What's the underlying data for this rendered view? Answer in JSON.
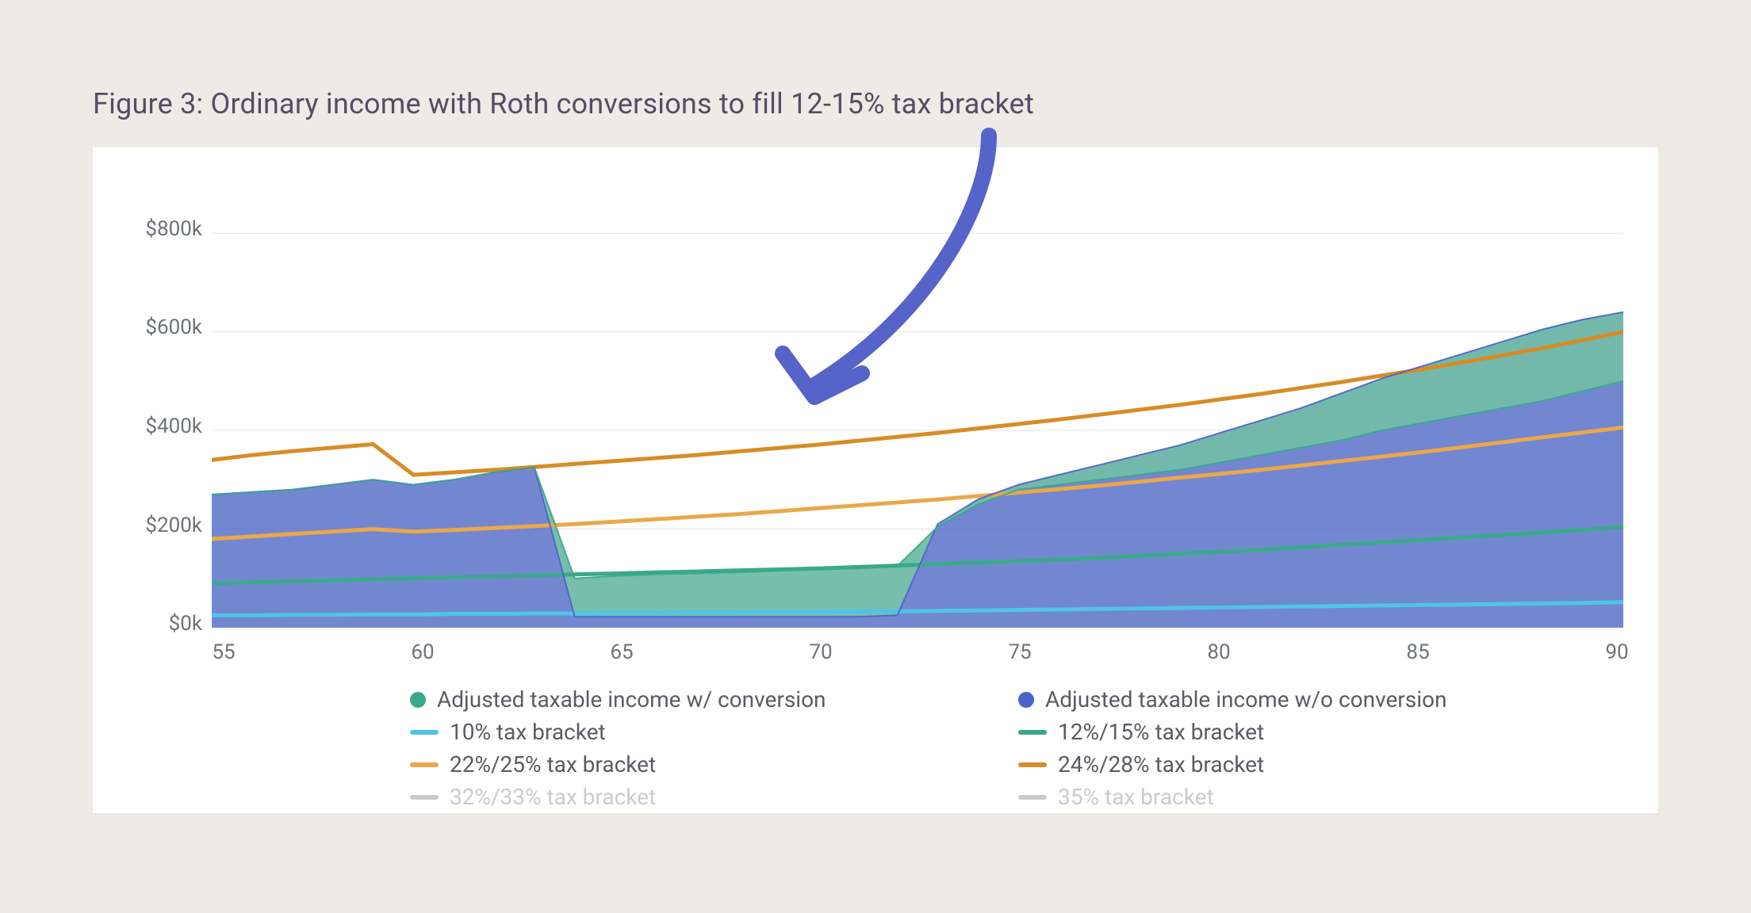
{
  "title": "Figure 3: Ordinary income with Roth conversions to fill 12-15% tax bracket",
  "chart_data": {
    "type": "area",
    "xlabel": "",
    "ylabel": "",
    "xlim": [
      55,
      90
    ],
    "ylim": [
      0,
      900
    ],
    "x_ticks": [
      55,
      60,
      65,
      70,
      75,
      80,
      85,
      90
    ],
    "y_ticks_labels": [
      "$0k",
      "$200k",
      "$400k",
      "$600k",
      "$800k"
    ],
    "y_ticks_values": [
      0,
      200,
      400,
      600,
      800
    ],
    "x": [
      55,
      56,
      57,
      58,
      59,
      60,
      61,
      62,
      63,
      64,
      65,
      66,
      67,
      68,
      69,
      70,
      71,
      72,
      73,
      74,
      75,
      76,
      77,
      78,
      79,
      80,
      81,
      82,
      83,
      84,
      85,
      86,
      87,
      88,
      89,
      90
    ],
    "series": [
      {
        "name": "Adjusted taxable income w/ conversion",
        "kind": "area",
        "color": "#6fc0a3",
        "values": [
          270,
          275,
          280,
          290,
          300,
          290,
          300,
          315,
          325,
          100,
          105,
          108,
          110,
          112,
          115,
          118,
          120,
          125,
          205,
          250,
          280,
          290,
          300,
          310,
          320,
          335,
          350,
          365,
          380,
          400,
          415,
          430,
          445,
          460,
          480,
          500
        ]
      },
      {
        "name": "Adjusted taxable income w/o conversion",
        "kind": "area",
        "color": "#5a72c9",
        "values": [
          270,
          275,
          280,
          290,
          300,
          290,
          300,
          315,
          325,
          22,
          22,
          22,
          22,
          22,
          22,
          22,
          22,
          25,
          210,
          260,
          290,
          310,
          330,
          350,
          370,
          395,
          420,
          445,
          475,
          505,
          530,
          555,
          580,
          605,
          625,
          640
        ]
      },
      {
        "name": "10% tax bracket",
        "kind": "line",
        "color": "#4fc3e8",
        "values": [
          25,
          25,
          26,
          26,
          27,
          27,
          28,
          28,
          29,
          29,
          30,
          30,
          31,
          31,
          32,
          32,
          33,
          33,
          34,
          35,
          36,
          37,
          38,
          39,
          40,
          41,
          42,
          43,
          44,
          45,
          46,
          47,
          48,
          49,
          50,
          52
        ]
      },
      {
        "name": "12%/15% tax bracket",
        "kind": "line",
        "color": "#3aa98a",
        "values": [
          90,
          92,
          94,
          96,
          98,
          100,
          102,
          104,
          106,
          108,
          110,
          112,
          114,
          116,
          118,
          120,
          123,
          126,
          129,
          132,
          135,
          138,
          142,
          146,
          150,
          154,
          158,
          163,
          168,
          173,
          178,
          183,
          188,
          193,
          198,
          205
        ]
      },
      {
        "name": "22%/25% tax bracket",
        "kind": "line",
        "color": "#eaa84a",
        "values": [
          180,
          185,
          190,
          195,
          200,
          195,
          198,
          202,
          206,
          210,
          215,
          220,
          225,
          230,
          236,
          242,
          248,
          254,
          260,
          267,
          274,
          281,
          288,
          296,
          304,
          312,
          320,
          329,
          338,
          347,
          356,
          366,
          376,
          386,
          396,
          406
        ]
      },
      {
        "name": "24%/28% tax bracket",
        "kind": "line",
        "color": "#d88c27",
        "values": [
          340,
          350,
          358,
          365,
          372,
          310,
          315,
          320,
          326,
          332,
          338,
          344,
          350,
          357,
          364,
          371,
          379,
          387,
          395,
          404,
          413,
          422,
          432,
          442,
          452,
          463,
          474,
          486,
          498,
          511,
          524,
          538,
          552,
          567,
          583,
          600
        ]
      },
      {
        "name": "32%/33% tax bracket",
        "kind": "line",
        "color": "#c9cccf",
        "muted": true,
        "values": null
      },
      {
        "name": "35% tax bracket",
        "kind": "line",
        "color": "#c9cccf",
        "muted": true,
        "values": null
      }
    ],
    "annotation_arrow": {
      "from": [
        70.5,
        900
      ],
      "to": [
        66.3,
        200
      ],
      "color": "#5663c8"
    }
  },
  "legend": {
    "items": [
      {
        "label": "Adjusted taxable income w/ conversion",
        "swatch": "dot",
        "color": "#3aa98a"
      },
      {
        "label": "Adjusted taxable income w/o conversion",
        "swatch": "dot",
        "color": "#4a63c9"
      },
      {
        "label": "10% tax bracket",
        "swatch": "line",
        "color": "#4fc3e8"
      },
      {
        "label": "12%/15% tax bracket",
        "swatch": "line",
        "color": "#3aa98a"
      },
      {
        "label": "22%/25% tax bracket",
        "swatch": "line",
        "color": "#eaa84a"
      },
      {
        "label": "24%/28% tax bracket",
        "swatch": "line",
        "color": "#d88c27"
      },
      {
        "label": "32%/33% tax bracket",
        "swatch": "line",
        "color": "#c9cccf",
        "muted": true
      },
      {
        "label": "35% tax bracket",
        "swatch": "line",
        "color": "#c9cccf",
        "muted": true
      }
    ]
  }
}
